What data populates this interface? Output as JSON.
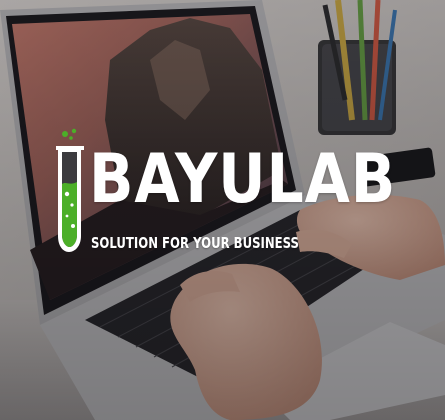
{
  "brand": {
    "name": "BAYULAB",
    "tagline": "SOLUTION FOR YOUR BUSINESS"
  },
  "logo": {
    "icon": "test-tube-icon",
    "liquid_color": "#4caf28",
    "outline_color": "#ffffff"
  },
  "colors": {
    "text": "#ffffff"
  }
}
